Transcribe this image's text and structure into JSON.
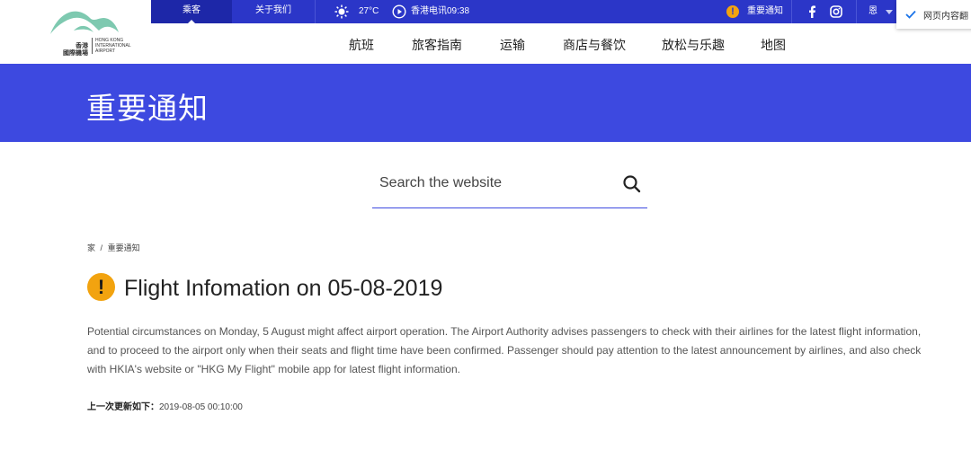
{
  "logo": {
    "cn": "香港\n國際機場",
    "en": "HONG KONG\nINTERNATIONAL\nAIRPORT",
    "color": "#7ec9b0"
  },
  "topbar": {
    "tab_passenger": "乘客",
    "tab_about": "关于我们",
    "weather_icon": "sun-icon",
    "temperature": "27°C",
    "time_icon": "play-circle-icon",
    "time_text": "香港电讯09:38",
    "notice_label": "重要通知",
    "social": [
      "facebook-icon",
      "instagram-icon"
    ],
    "lang_label": "恩",
    "color": "#2b36c8"
  },
  "translate_popup": {
    "label": "网页内容翻"
  },
  "mainnav": {
    "items": [
      "航班",
      "旅客指南",
      "运输",
      "商店与餐饮",
      "放松与乐趣",
      "地图"
    ]
  },
  "banner": {
    "title": "重要通知",
    "color": "#3d49e0"
  },
  "search": {
    "placeholder": "Search the website"
  },
  "breadcrumb": {
    "home": "家",
    "separator": "/",
    "current": "重要通知"
  },
  "article": {
    "title": "Flight Infomation on 05-08-2019",
    "body": "Potential circumstances on Monday, 5 August might affect airport operation. The Airport Authority advises passengers to check with their airlines for the latest flight information, and to proceed to the airport only when their seats and flight time have been confirmed. Passenger should pay attention to the latest announcement by airlines, and also check with HKIA's website or \"HKG My Flight\" mobile app for latest flight information.",
    "updated_label": "上一次更新如下：",
    "updated_value": "2019-08-05 00:10:00",
    "alert_color": "#f2a30f"
  }
}
